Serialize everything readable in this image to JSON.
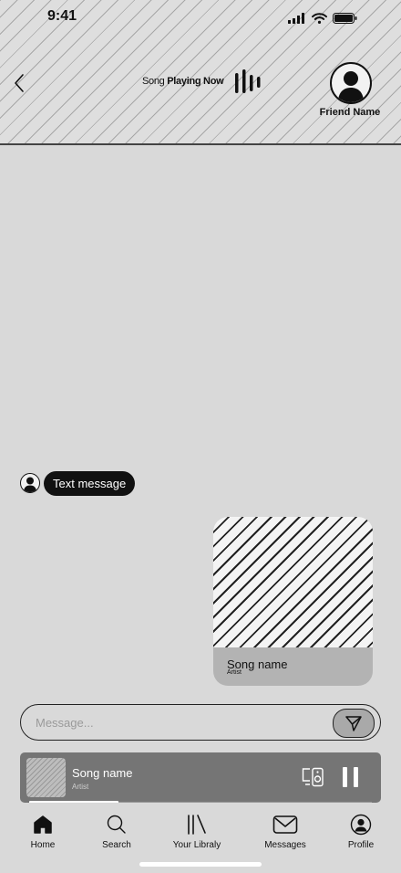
{
  "status_bar": {
    "time": "9:41",
    "icons": [
      "signal-icon",
      "wifi-icon",
      "battery-icon"
    ]
  },
  "header": {
    "now_playing_prefix": "Song",
    "now_playing_bold": "Playing Now",
    "friend_name": "Friend Name",
    "icons": [
      "back-chevron-icon",
      "sound-wave-icon",
      "friend-avatar-icon"
    ]
  },
  "chat": {
    "received_message": "Text message",
    "shared_song": {
      "title": "Song name",
      "artist": "Artist"
    }
  },
  "composer": {
    "placeholder": "Message...",
    "send_icon": "send-icon"
  },
  "mini_player": {
    "title": "Song name",
    "artist": "Artist",
    "progress": 0.26,
    "icons": [
      "connect-device-icon",
      "pause-icon"
    ]
  },
  "tabs": [
    {
      "label": "Home",
      "icon": "home-icon",
      "active": true
    },
    {
      "label": "Search",
      "icon": "search-icon",
      "active": false
    },
    {
      "label": "Your Libraly",
      "icon": "library-icon",
      "active": false
    },
    {
      "label": "Messages",
      "icon": "messages-icon",
      "active": false
    },
    {
      "label": "Profile",
      "icon": "profile-icon",
      "active": false
    }
  ],
  "colors": {
    "background": "#d9d9d9",
    "bubble": "#111111",
    "player": "#757575",
    "card_footer": "#b3b3b3"
  }
}
